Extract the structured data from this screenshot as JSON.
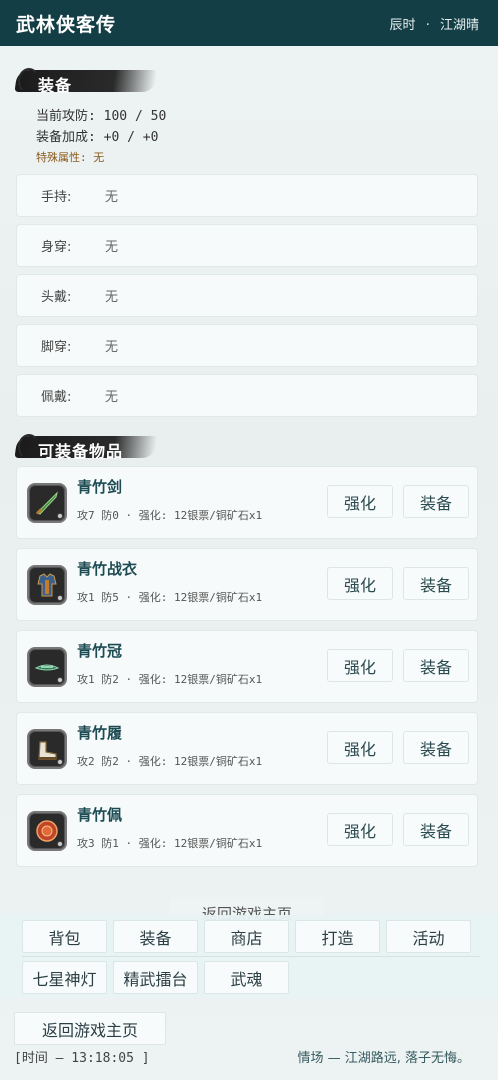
{
  "header": {
    "title": "武林侠客传",
    "time_of_day": "辰时",
    "separator": "·",
    "weather": "江湖晴"
  },
  "equip_section": {
    "title": "装备",
    "attack_defense": "当前攻防: 100 / 50",
    "bonus": "装备加成: +0 / +0",
    "special": "特殊属性: 无"
  },
  "slots": [
    {
      "name": "手持:",
      "value": "无"
    },
    {
      "name": "身穿:",
      "value": "无"
    },
    {
      "name": "头戴:",
      "value": "无"
    },
    {
      "name": "脚穿:",
      "value": "无"
    },
    {
      "name": "佩戴:",
      "value": "无"
    }
  ],
  "items_section": {
    "title": "可装备物品",
    "enhance_label": "强化",
    "equip_label": "装备"
  },
  "items": [
    {
      "name": "青竹剑",
      "desc": "攻7 防0 · 强化: 12银票/铜矿石x1",
      "icon": "sword-icon"
    },
    {
      "name": "青竹战衣",
      "desc": "攻1 防5 · 强化: 12银票/铜矿石x1",
      "icon": "armor-icon"
    },
    {
      "name": "青竹冠",
      "desc": "攻1 防2 · 强化: 12银票/铜矿石x1",
      "icon": "helmet-icon"
    },
    {
      "name": "青竹履",
      "desc": "攻2 防2 · 强化: 12银票/铜矿石x1",
      "icon": "boots-icon"
    },
    {
      "name": "青竹佩",
      "desc": "攻3 防1 · 强化: 12银票/铜矿石x1",
      "icon": "pendant-icon"
    }
  ],
  "nav": {
    "ghost_back": "返回游戏主页",
    "row1": [
      "背包",
      "装备",
      "商店",
      "打造",
      "活动"
    ],
    "row2": [
      "七星神灯",
      "精武擂台",
      "武魂"
    ]
  },
  "back_home": "返回游戏主页",
  "footer": {
    "time": "[时间 — 13:18:05 ]",
    "message": "情场 — 江湖路远, 落子无悔。"
  }
}
